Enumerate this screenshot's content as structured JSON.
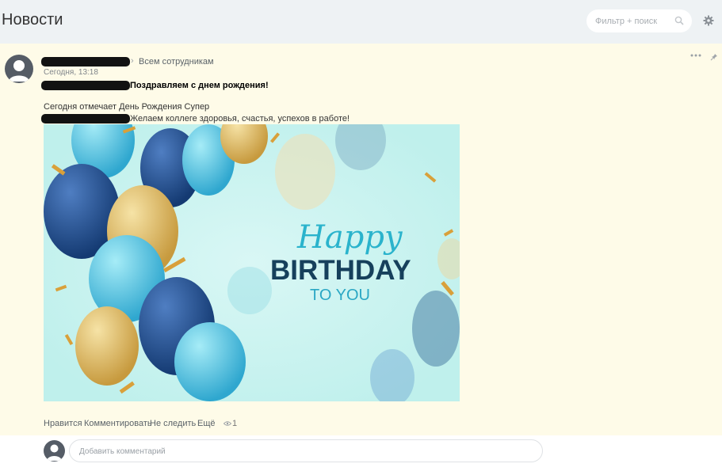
{
  "header": {
    "title": "Новости",
    "search_placeholder": "Фильтр + поиск",
    "search_icon": "search-icon",
    "settings_icon": "gear-icon"
  },
  "post": {
    "recipients": "Всем сотрудникам",
    "time": "Сегодня, 13:18",
    "title": "Поздравляем с днем рождения!",
    "body_line1": "Сегодня отмечает День Рождения Супер",
    "body_line2": "Желаем коллеге здоровья, счастья, успехов в работе!",
    "image": {
      "line1": "Happy",
      "line2": "BIRTHDAY",
      "line3": "TO YOU"
    },
    "actions": {
      "like": "Нравится",
      "comment": "Комментировать",
      "unfollow": "Не следить",
      "more": "Ещё"
    },
    "views": "1"
  },
  "comment": {
    "placeholder": "Добавить комментарий"
  },
  "colors": {
    "post_background": "#fefbe8",
    "header_background": "#eef2f4",
    "banner_background": "#bff0ec",
    "birthday_text": "#16405c",
    "happy_text": "#2ab3cc"
  }
}
